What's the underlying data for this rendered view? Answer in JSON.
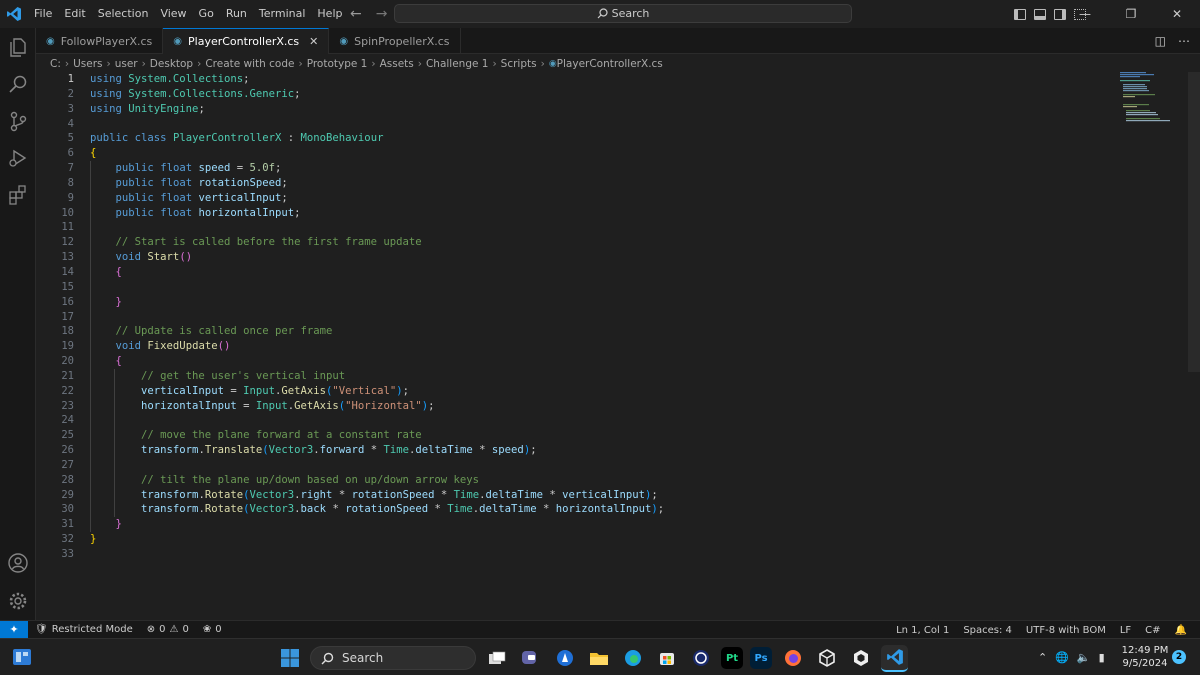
{
  "menu": [
    "File",
    "Edit",
    "Selection",
    "View",
    "Go",
    "Run",
    "Terminal",
    "Help"
  ],
  "search": {
    "label": "Search"
  },
  "tabs": [
    {
      "label": "FollowPlayerX.cs",
      "active": false
    },
    {
      "label": "PlayerControllerX.cs",
      "active": true
    },
    {
      "label": "SpinPropellerX.cs",
      "active": false
    }
  ],
  "breadcrumb": [
    "C:",
    "Users",
    "user",
    "Desktop",
    "Create with code",
    "Prototype 1",
    "Assets",
    "Challenge 1",
    "Scripts",
    "PlayerControllerX.cs"
  ],
  "editor": {
    "current_line": 1,
    "lines": [
      {
        "n": "1",
        "indent": 0,
        "t": [
          [
            "kw",
            "using"
          ],
          [
            "",
            "",
            " "
          ],
          [
            "ty",
            "System.Collections"
          ],
          [
            "",
            ";"
          ]
        ]
      },
      {
        "n": "2",
        "indent": 0,
        "t": [
          [
            "kw",
            "using"
          ],
          [
            "",
            " "
          ],
          [
            "ty",
            "System.Collections.Generic"
          ],
          [
            "",
            ";"
          ]
        ]
      },
      {
        "n": "3",
        "indent": 0,
        "t": [
          [
            "kw",
            "using"
          ],
          [
            "",
            " "
          ],
          [
            "ty",
            "UnityEngine"
          ],
          [
            "",
            ";"
          ]
        ]
      },
      {
        "n": "4",
        "indent": 0,
        "t": []
      },
      {
        "n": "5",
        "indent": 0,
        "t": [
          [
            "kw",
            "public"
          ],
          [
            "",
            " "
          ],
          [
            "kw",
            "class"
          ],
          [
            "",
            " "
          ],
          [
            "ty",
            "PlayerControllerX"
          ],
          [
            "",
            " : "
          ],
          [
            "ty",
            "MonoBehaviour"
          ]
        ]
      },
      {
        "n": "6",
        "indent": 0,
        "t": [
          [
            "br1",
            "{"
          ]
        ]
      },
      {
        "n": "7",
        "indent": 1,
        "t": [
          [
            "kw",
            "public"
          ],
          [
            "",
            " "
          ],
          [
            "kw",
            "float"
          ],
          [
            "",
            " "
          ],
          [
            "var",
            "speed"
          ],
          [
            "",
            " = "
          ],
          [
            "num",
            "5.0f"
          ],
          [
            "",
            ";"
          ]
        ]
      },
      {
        "n": "8",
        "indent": 1,
        "t": [
          [
            "kw",
            "public"
          ],
          [
            "",
            " "
          ],
          [
            "kw",
            "float"
          ],
          [
            "",
            " "
          ],
          [
            "var",
            "rotationSpeed"
          ],
          [
            "",
            ";"
          ]
        ]
      },
      {
        "n": "9",
        "indent": 1,
        "t": [
          [
            "kw",
            "public"
          ],
          [
            "",
            " "
          ],
          [
            "kw",
            "float"
          ],
          [
            "",
            " "
          ],
          [
            "var",
            "verticalInput"
          ],
          [
            "",
            ";"
          ]
        ]
      },
      {
        "n": "10",
        "indent": 1,
        "t": [
          [
            "kw",
            "public"
          ],
          [
            "",
            " "
          ],
          [
            "kw",
            "float"
          ],
          [
            "",
            " "
          ],
          [
            "var",
            "horizontalInput"
          ],
          [
            "",
            ";"
          ]
        ]
      },
      {
        "n": "11",
        "indent": 1,
        "t": []
      },
      {
        "n": "12",
        "indent": 1,
        "t": [
          [
            "com",
            "// Start is called before the first frame update"
          ]
        ]
      },
      {
        "n": "13",
        "indent": 1,
        "t": [
          [
            "kw",
            "void"
          ],
          [
            "",
            " "
          ],
          [
            "fn",
            "Start"
          ],
          [
            "br2",
            "()"
          ]
        ]
      },
      {
        "n": "14",
        "indent": 1,
        "t": [
          [
            "br2",
            "{"
          ]
        ]
      },
      {
        "n": "15",
        "indent": 1,
        "t": []
      },
      {
        "n": "16",
        "indent": 1,
        "t": [
          [
            "br2",
            "}"
          ]
        ]
      },
      {
        "n": "17",
        "indent": 1,
        "t": []
      },
      {
        "n": "18",
        "indent": 1,
        "t": [
          [
            "com",
            "// Update is called once per frame"
          ]
        ]
      },
      {
        "n": "19",
        "indent": 1,
        "t": [
          [
            "kw",
            "void"
          ],
          [
            "",
            " "
          ],
          [
            "fn",
            "FixedUpdate"
          ],
          [
            "br2",
            "()"
          ]
        ]
      },
      {
        "n": "20",
        "indent": 1,
        "t": [
          [
            "br2",
            "{"
          ]
        ]
      },
      {
        "n": "21",
        "indent": 2,
        "t": [
          [
            "com",
            "// get the user's vertical input"
          ]
        ]
      },
      {
        "n": "22",
        "indent": 2,
        "t": [
          [
            "var",
            "verticalInput"
          ],
          [
            "",
            " = "
          ],
          [
            "ty",
            "Input"
          ],
          [
            "",
            "."
          ],
          [
            "fn",
            "GetAxis"
          ],
          [
            "br3",
            "("
          ],
          [
            "str",
            "\"Vertical\""
          ],
          [
            "br3",
            ")"
          ],
          [
            "",
            ";"
          ]
        ]
      },
      {
        "n": "23",
        "indent": 2,
        "t": [
          [
            "var",
            "horizontalInput"
          ],
          [
            "",
            " = "
          ],
          [
            "ty",
            "Input"
          ],
          [
            "",
            "."
          ],
          [
            "fn",
            "GetAxis"
          ],
          [
            "br3",
            "("
          ],
          [
            "str",
            "\"Horizontal\""
          ],
          [
            "br3",
            ")"
          ],
          [
            "",
            ";"
          ]
        ]
      },
      {
        "n": "24",
        "indent": 2,
        "t": []
      },
      {
        "n": "25",
        "indent": 2,
        "t": [
          [
            "com",
            "// move the plane forward at a constant rate"
          ]
        ]
      },
      {
        "n": "26",
        "indent": 2,
        "t": [
          [
            "var",
            "transform"
          ],
          [
            "",
            "."
          ],
          [
            "fn",
            "Translate"
          ],
          [
            "br3",
            "("
          ],
          [
            "ty",
            "Vector3"
          ],
          [
            "",
            "."
          ],
          [
            "var",
            "forward"
          ],
          [
            "",
            " * "
          ],
          [
            "ty",
            "Time"
          ],
          [
            "",
            "."
          ],
          [
            "var",
            "deltaTime"
          ],
          [
            "",
            " * "
          ],
          [
            "var",
            "speed"
          ],
          [
            "br3",
            ")"
          ],
          [
            "",
            ";"
          ]
        ]
      },
      {
        "n": "27",
        "indent": 2,
        "t": []
      },
      {
        "n": "28",
        "indent": 2,
        "t": [
          [
            "com",
            "// tilt the plane up/down based on up/down arrow keys"
          ]
        ]
      },
      {
        "n": "29",
        "indent": 2,
        "t": [
          [
            "var",
            "transform"
          ],
          [
            "",
            "."
          ],
          [
            "fn",
            "Rotate"
          ],
          [
            "br3",
            "("
          ],
          [
            "ty",
            "Vector3"
          ],
          [
            "",
            "."
          ],
          [
            "var",
            "right"
          ],
          [
            "",
            " * "
          ],
          [
            "var",
            "rotationSpeed"
          ],
          [
            "",
            " * "
          ],
          [
            "ty",
            "Time"
          ],
          [
            "",
            "."
          ],
          [
            "var",
            "deltaTime"
          ],
          [
            "",
            " * "
          ],
          [
            "var",
            "verticalInput"
          ],
          [
            "br3",
            ")"
          ],
          [
            "",
            ";"
          ]
        ]
      },
      {
        "n": "30",
        "indent": 2,
        "t": [
          [
            "var",
            "transform"
          ],
          [
            "",
            "."
          ],
          [
            "fn",
            "Rotate"
          ],
          [
            "br3",
            "("
          ],
          [
            "ty",
            "Vector3"
          ],
          [
            "",
            "."
          ],
          [
            "var",
            "back"
          ],
          [
            "",
            " * "
          ],
          [
            "var",
            "rotationSpeed"
          ],
          [
            "",
            " * "
          ],
          [
            "ty",
            "Time"
          ],
          [
            "",
            "."
          ],
          [
            "var",
            "deltaTime"
          ],
          [
            "",
            " * "
          ],
          [
            "var",
            "horizontalInput"
          ],
          [
            "br3",
            ")"
          ],
          [
            "",
            ";"
          ]
        ]
      },
      {
        "n": "31",
        "indent": 1,
        "t": [
          [
            "br2",
            "}"
          ]
        ]
      },
      {
        "n": "32",
        "indent": 0,
        "t": [
          [
            "br1",
            "}"
          ]
        ]
      },
      {
        "n": "33",
        "indent": 0,
        "t": []
      }
    ]
  },
  "statusbar": {
    "restricted": "Restricted Mode",
    "errors": "0",
    "warnings": "0",
    "ports": "0",
    "position": "Ln 1, Col 1",
    "spaces": "Spaces: 4",
    "encoding": "UTF-8 with BOM",
    "eol": "LF",
    "language": "C#"
  },
  "taskbar": {
    "search": "Search",
    "apps": [
      "Files",
      "Meet",
      "Copilot",
      "File Explorer",
      "Edge",
      "Microsoft Store",
      "Cinema 4D",
      "PyCharm",
      "Photoshop",
      "Firefox",
      "Unity",
      "Unity Hub",
      "Visual Studio Code"
    ],
    "time": "12:49 PM",
    "date": "9/5/2024",
    "notifications": "2"
  }
}
